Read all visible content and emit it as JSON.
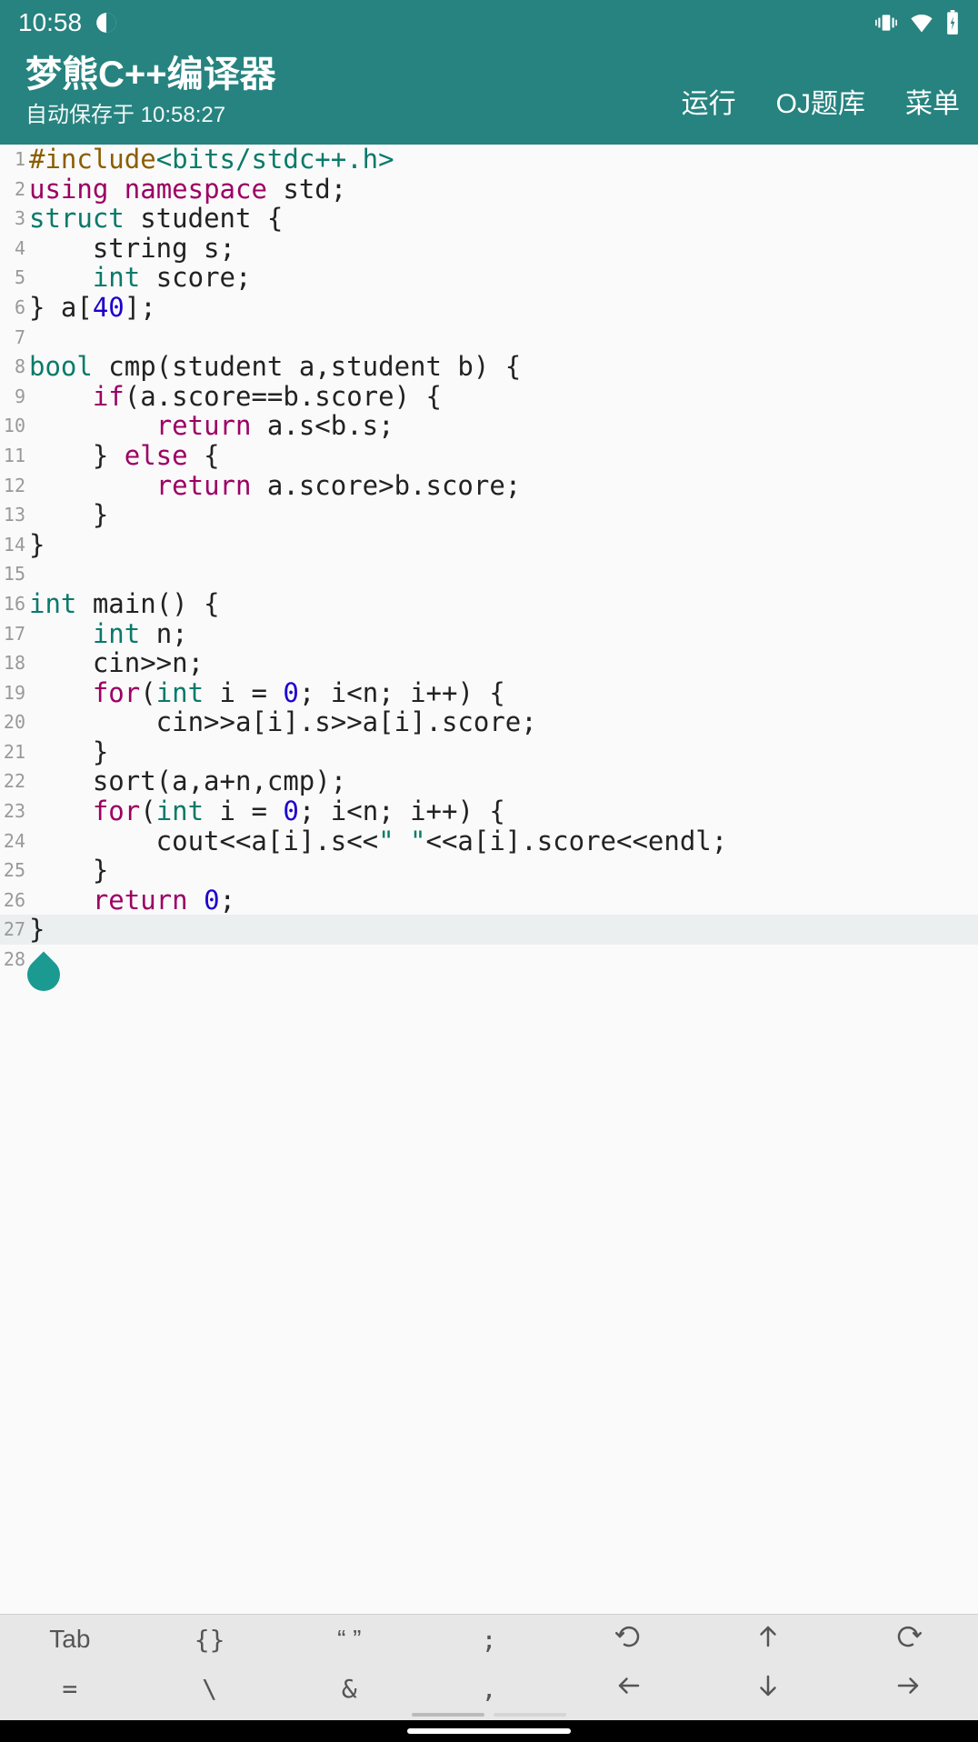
{
  "status": {
    "time": "10:58"
  },
  "header": {
    "title": "梦熊C++编译器",
    "subtitle": "自动保存于 10:58:27",
    "actions": {
      "run": "运行",
      "oj": "OJ题库",
      "menu": "菜单"
    }
  },
  "code": {
    "lines": [
      {
        "n": 1,
        "tokens": [
          [
            "#include",
            "pre"
          ],
          [
            "<bits/stdc++.h>",
            "inc"
          ]
        ]
      },
      {
        "n": 2,
        "tokens": [
          [
            "using",
            "kw"
          ],
          [
            " ",
            "id"
          ],
          [
            "namespace",
            "kw"
          ],
          [
            " std;",
            "id"
          ]
        ]
      },
      {
        "n": 3,
        "tokens": [
          [
            "struct",
            "type"
          ],
          [
            " student {",
            "id"
          ]
        ]
      },
      {
        "n": 4,
        "tokens": [
          [
            "    string s;",
            "id"
          ]
        ]
      },
      {
        "n": 5,
        "tokens": [
          [
            "    ",
            "id"
          ],
          [
            "int",
            "type"
          ],
          [
            " score;",
            "id"
          ]
        ]
      },
      {
        "n": 6,
        "tokens": [
          [
            "} a[",
            "id"
          ],
          [
            "40",
            "num"
          ],
          [
            "];",
            "id"
          ]
        ]
      },
      {
        "n": 7,
        "tokens": [
          [
            "",
            "id"
          ]
        ]
      },
      {
        "n": 8,
        "tokens": [
          [
            "bool",
            "type"
          ],
          [
            " cmp(student a,student b) {",
            "id"
          ]
        ]
      },
      {
        "n": 9,
        "tokens": [
          [
            "    ",
            "id"
          ],
          [
            "if",
            "kw"
          ],
          [
            "(a.score==b.score) {",
            "id"
          ]
        ]
      },
      {
        "n": 10,
        "tokens": [
          [
            "        ",
            "id"
          ],
          [
            "return",
            "kw"
          ],
          [
            " a.s<b.s;",
            "id"
          ]
        ]
      },
      {
        "n": 11,
        "tokens": [
          [
            "    } ",
            "id"
          ],
          [
            "else",
            "kw"
          ],
          [
            " {",
            "id"
          ]
        ]
      },
      {
        "n": 12,
        "tokens": [
          [
            "        ",
            "id"
          ],
          [
            "return",
            "kw"
          ],
          [
            " a.score>b.score;",
            "id"
          ]
        ]
      },
      {
        "n": 13,
        "tokens": [
          [
            "    }",
            "id"
          ]
        ]
      },
      {
        "n": 14,
        "tokens": [
          [
            "}",
            "id"
          ]
        ]
      },
      {
        "n": 15,
        "tokens": [
          [
            "",
            "id"
          ]
        ]
      },
      {
        "n": 16,
        "tokens": [
          [
            "int",
            "type"
          ],
          [
            " main() {",
            "id"
          ]
        ]
      },
      {
        "n": 17,
        "tokens": [
          [
            "    ",
            "id"
          ],
          [
            "int",
            "type"
          ],
          [
            " n;",
            "id"
          ]
        ]
      },
      {
        "n": 18,
        "tokens": [
          [
            "    cin>>n;",
            "id"
          ]
        ]
      },
      {
        "n": 19,
        "tokens": [
          [
            "    ",
            "id"
          ],
          [
            "for",
            "kw"
          ],
          [
            "(",
            "id"
          ],
          [
            "int",
            "type"
          ],
          [
            " i = ",
            "id"
          ],
          [
            "0",
            "num"
          ],
          [
            "; i<n; i++) {",
            "id"
          ]
        ]
      },
      {
        "n": 20,
        "tokens": [
          [
            "        cin>>a[i].s>>a[i].score;",
            "id"
          ]
        ]
      },
      {
        "n": 21,
        "tokens": [
          [
            "    }",
            "id"
          ]
        ]
      },
      {
        "n": 22,
        "tokens": [
          [
            "    sort(a,a+n,cmp);",
            "id"
          ]
        ]
      },
      {
        "n": 23,
        "tokens": [
          [
            "    ",
            "id"
          ],
          [
            "for",
            "kw"
          ],
          [
            "(",
            "id"
          ],
          [
            "int",
            "type"
          ],
          [
            " i = ",
            "id"
          ],
          [
            "0",
            "num"
          ],
          [
            "; i<n; i++) {",
            "id"
          ]
        ]
      },
      {
        "n": 24,
        "tokens": [
          [
            "        cout<<a[i].s<<",
            "id"
          ],
          [
            "\" \"",
            "str"
          ],
          [
            "<<a[i].score<<endl;",
            "id"
          ]
        ]
      },
      {
        "n": 25,
        "tokens": [
          [
            "    }",
            "id"
          ]
        ]
      },
      {
        "n": 26,
        "tokens": [
          [
            "    ",
            "id"
          ],
          [
            "return",
            "kw"
          ],
          [
            " ",
            "id"
          ],
          [
            "0",
            "num"
          ],
          [
            ";",
            "id"
          ]
        ]
      },
      {
        "n": 27,
        "tokens": [
          [
            "}",
            "id"
          ]
        ],
        "hl": true
      },
      {
        "n": 28,
        "tokens": [
          [
            "",
            "id"
          ]
        ]
      }
    ]
  },
  "toolbar": {
    "row1": [
      "Tab",
      "{}",
      "“ ”",
      ";"
    ],
    "row2": [
      "=",
      "\\",
      "&",
      ","
    ]
  }
}
